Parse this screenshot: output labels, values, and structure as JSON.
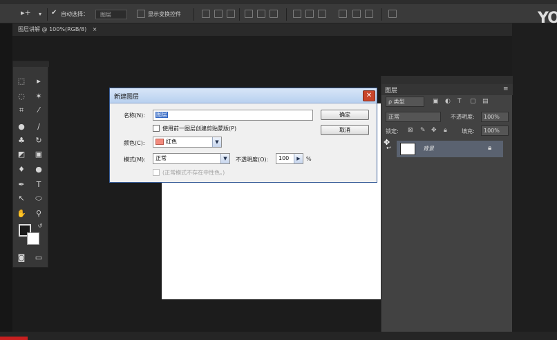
{
  "options_bar": {
    "auto_select_label": "自动选择：",
    "auto_select_value": "图层",
    "show_transform_label": "显示变换控件",
    "logo_text": "YO"
  },
  "document": {
    "tab_label": "图层讲解 @ 100%(RGB/8)",
    "tab_close": "×"
  },
  "layers_panel": {
    "title": "图层",
    "filter_label": "ρ 类型",
    "blend_mode": "正常",
    "opacity_label": "不透明度:",
    "opacity_value": "100%",
    "lock_label": "锁定:",
    "fill_label": "填充:",
    "fill_value": "100%",
    "layers": [
      {
        "name": "背景",
        "locked": true
      }
    ]
  },
  "dialog": {
    "title": "新建图层",
    "name_label": "名称(N):",
    "name_value": "图层",
    "clip_checkbox_label": "使用前一图层创建剪贴蒙版(P)",
    "color_label": "颜色(C):",
    "color_value": "红色",
    "mode_label": "模式(M):",
    "mode_value": "正常",
    "opacity_label": "不透明度(O):",
    "opacity_value": "100",
    "opacity_unit": "%",
    "neutral_label": "(正常模式不存在中性色。)",
    "ok_label": "确定",
    "cancel_label": "取消"
  },
  "colors": {
    "title_bar": "#b8d0ef",
    "selection": "#3368c4",
    "swatch_red": "#f28a7d",
    "layer_selected": "#5a6270"
  }
}
